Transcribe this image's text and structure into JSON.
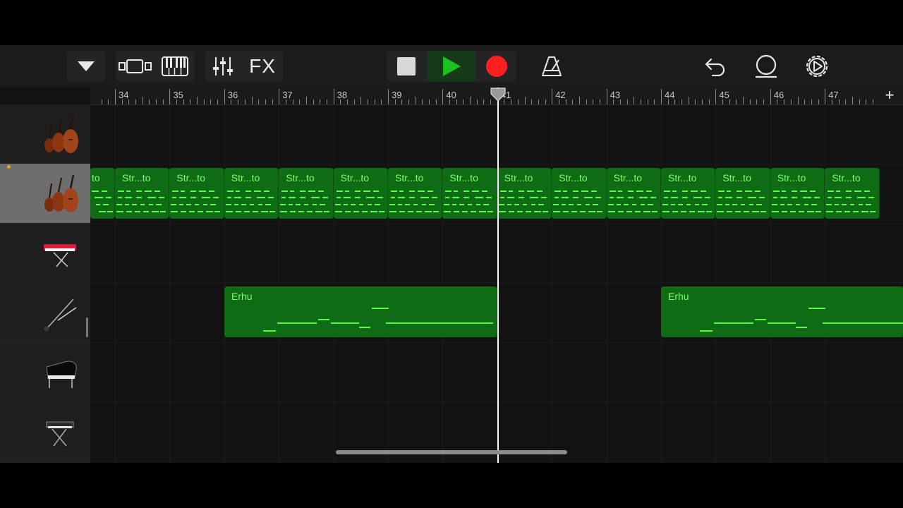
{
  "toolbar": {
    "fx_label": "FX",
    "icons": [
      "tracks-dropdown-icon",
      "tracks-view-icon",
      "keyboard-icon",
      "mixer-icon",
      "stop-icon",
      "play-icon",
      "record-icon",
      "metronome-icon",
      "undo-icon",
      "loop-browser-icon",
      "settings-icon"
    ],
    "play_color": "#19a51c",
    "record_color": "#ff2222"
  },
  "ruler": {
    "bars": [
      "34",
      "35",
      "36",
      "37",
      "38",
      "39",
      "40",
      "41",
      "42",
      "43",
      "44",
      "45",
      "46",
      "47"
    ],
    "add_label": "+"
  },
  "tracks": [
    {
      "instrument": "strings-icon",
      "selected": false
    },
    {
      "instrument": "strings-icon",
      "selected": true
    },
    {
      "instrument": "synth-keyboard-icon",
      "selected": false
    },
    {
      "instrument": "erhu-icon",
      "selected": false
    },
    {
      "instrument": "grand-piano-icon",
      "selected": false
    },
    {
      "instrument": "keyboard-stand-icon",
      "selected": false
    }
  ],
  "regions": {
    "strings_label": "Str...to",
    "strings_partial_label": "to",
    "erhu_label": "Erhu"
  },
  "colors": {
    "region_green": "#0f6b14",
    "note_green": "#52ff45",
    "record_dot": "#f0a020"
  }
}
